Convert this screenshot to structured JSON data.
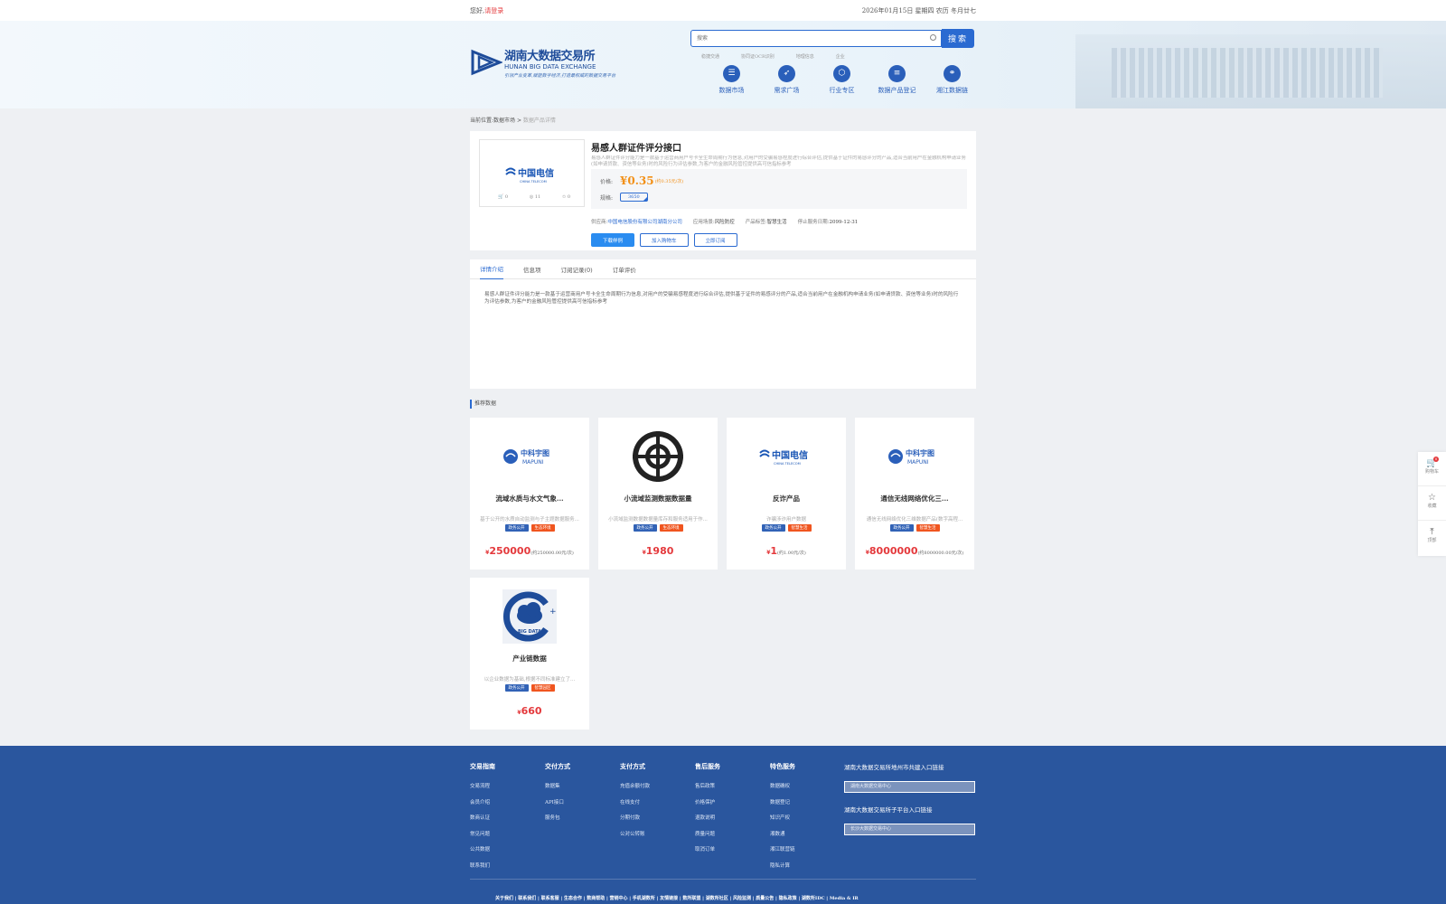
{
  "topbar": {
    "greeting": "您好,",
    "login": "请登录",
    "date": "2026年01月15日 星期四 农历 冬月廿七"
  },
  "header": {
    "logo": {
      "cn": "湖南大数据交易所",
      "en": "HUNAN BIG DATA EXCHANGE",
      "slogan": "引领产业变革,赋能数字经济,打造最权威的数据交易平台"
    },
    "search_placeholder": "搜索",
    "search_button": "搜索",
    "hotwords": [
      "稳捷交通",
      "协同证OCR识别",
      "地理信息",
      "企业"
    ],
    "nav": [
      {
        "label": "数据市场",
        "icon": "database-icon",
        "glyph": "☰"
      },
      {
        "label": "需求广场",
        "icon": "compass-icon",
        "glyph": "➶"
      },
      {
        "label": "行业专区",
        "icon": "cube-icon",
        "glyph": "⬡"
      },
      {
        "label": "数据产品登记",
        "icon": "register-icon",
        "glyph": "≡"
      },
      {
        "label": "湘江数据链",
        "icon": "chain-icon",
        "glyph": "⚭"
      }
    ]
  },
  "breadcrumb": {
    "prefix": "当前位置:",
    "market": "数据市场",
    "sep": ">",
    "current": "数据产品详情"
  },
  "product": {
    "title": "易感人群证件评分接口",
    "desc": "易感人群证件评分能力是一款基于运营商用户号卡全生命周期行为信息,对用户的受骗易感程度进行综合评估,提供基于证件的易感评分的产品,适合当前用户在金融机构申请业务(如申请贷款、资信等业务)时的风险行为评估参数,为客户的金融风险管控提供高可信指标参考",
    "price_label": "价格:",
    "price": "¥0.35",
    "price_unit": "(约0.35元/次)",
    "spec_label": "规格:",
    "spec": "3650",
    "provider_label": "供应商:",
    "provider": "中国电信股份有限公司湖南分公司",
    "scene_label": "应用场景:",
    "scene": "风险防控",
    "tag_label": "产品标签:",
    "tag": "智慧生活",
    "end_label": "停止服务日期:",
    "end_date": "2099-12-31",
    "stats": {
      "cart": "0",
      "views": "11",
      "fav": "0"
    },
    "brand": "中国电信",
    "brand_en": "CHINA TELECOM",
    "buttons": {
      "download": "下载样例",
      "add_cart": "加入购物车",
      "subscribe": "立即订阅"
    }
  },
  "tabs": {
    "items": [
      "详情介绍",
      "信息项",
      "订阅记录(0)",
      "订单评价"
    ],
    "content": "易感人群证件评分能力是一款基于运营商用户号卡全生命周期行为信息,对用户的受骗易感程度进行综合评估,提供基于证件的易感评分的产品,适合当前用户在金融机构申请业务(如申请贷款、资信等业务)时的风险行为评估参数,为客户的金融风险管控提供高可信指标参考"
  },
  "recommend": {
    "title": "推荐数据",
    "cards": [
      {
        "name": "流域水质与水文气象...",
        "desc": "基于公开的水质自动监测与子主题数据服务...",
        "tag1": "政务公开",
        "tag2": "生态环境",
        "yen": "¥",
        "price": "250000",
        "per": "(约250000.00元/次)",
        "logo": "mapuni"
      },
      {
        "name": "小流域监测数据数据量",
        "desc": "小流域监测数据数据量库存和服务适用于作...",
        "tag1": "政务公开",
        "tag2": "生态环境",
        "yen": "¥",
        "price": "1980",
        "per": "",
        "logo": "target"
      },
      {
        "name": "反诈产品",
        "desc": "诈骗涉诈用户数据",
        "tag1": "政务公开",
        "tag2": "智慧生活",
        "yen": "¥",
        "price": "1",
        "per": "(约1.00元/次)",
        "logo": "telecom"
      },
      {
        "name": "通信无线网络优化三...",
        "desc": "通信无线网络优化三维数据产品(数字高程...",
        "tag1": "政务公开",
        "tag2": "智慧生活",
        "yen": "¥",
        "price": "8000000",
        "per": "(约8000000.00元/次)",
        "logo": "mapuni"
      },
      {
        "name": "产业链数据",
        "desc": "以企业数据为基础,根据不同标准建立了...",
        "tag1": "政务公开",
        "tag2": "智慧园区",
        "yen": "¥",
        "price": "660",
        "per": "",
        "logo": "bigdata"
      }
    ],
    "mapuni_cn": "中科宇图",
    "mapuni_en": "MAPUNI",
    "bigdata_text": "BIG DATA"
  },
  "footer": {
    "cols": [
      {
        "title": "交易指南",
        "items": [
          "交易流程",
          "会员介绍",
          "数商认证",
          "常见问题",
          "公共数据",
          "联系我们"
        ]
      },
      {
        "title": "交付方式",
        "items": [
          "数据集",
          "API接口",
          "服务包"
        ]
      },
      {
        "title": "支付方式",
        "items": [
          "充值余额付款",
          "在线支付",
          "分期付款",
          "公对公转账"
        ]
      },
      {
        "title": "售后服务",
        "items": [
          "售后政策",
          "价格保护",
          "退款说明",
          "质量问题",
          "取消订单"
        ]
      },
      {
        "title": "特色服务",
        "items": [
          "数据确权",
          "数据登记",
          "知识产权",
          "湘数通",
          "湘江联营链",
          "隐私计算"
        ]
      }
    ],
    "right_title1": "湖南大数据交易所地州市共建入口链接",
    "right_select1": "湖南大数据交易中心",
    "right_title2": "湖南大数据交易所子平台入口链接",
    "right_select2": "长沙大数据交易中心",
    "links": "关于我们 | 联系我们 | 联系客服 | 生态合作 | 数商帮助 | 营销中心 | 手机湖数所 | 友情链接 | 数所联盟 | 湖数所社区 | 风险监测 | 质量公告 | 隐私政策 | 湖数所IDC | Media & IR"
  },
  "floatbar": {
    "cart": "购物车",
    "cart_count": "0",
    "fav": "收藏",
    "top": "顶部"
  },
  "colors": {
    "primary": "#2a6ad1",
    "footer": "#2a569e",
    "price": "#f29017",
    "red": "#e4393c"
  }
}
